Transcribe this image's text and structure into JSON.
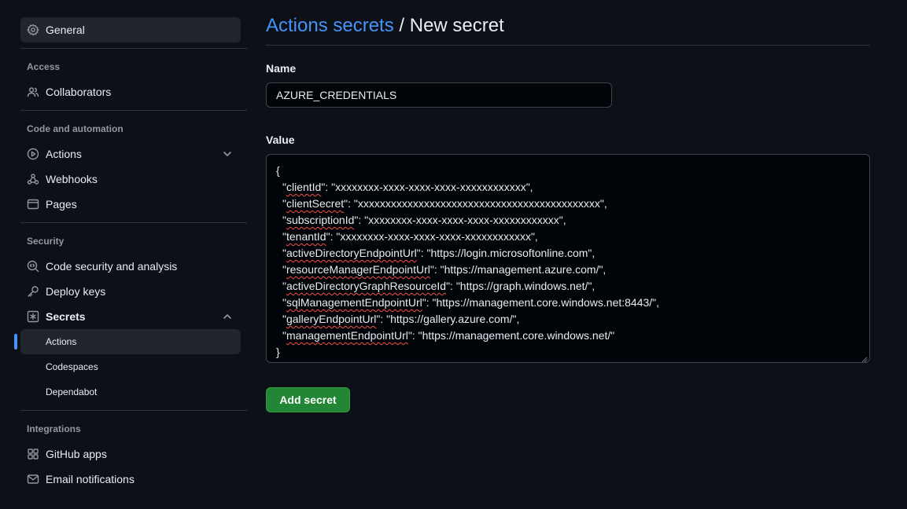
{
  "sidebar": {
    "general": "General",
    "access": {
      "heading": "Access",
      "collaborators": "Collaborators"
    },
    "code_automation": {
      "heading": "Code and automation",
      "actions": "Actions",
      "webhooks": "Webhooks",
      "pages": "Pages"
    },
    "security": {
      "heading": "Security",
      "code_security": "Code security and analysis",
      "deploy_keys": "Deploy keys",
      "secrets": "Secrets",
      "secrets_items": [
        "Actions",
        "Codespaces",
        "Dependabot"
      ]
    },
    "integrations": {
      "heading": "Integrations",
      "github_apps": "GitHub apps",
      "email_notifications": "Email notifications"
    }
  },
  "header": {
    "link": "Actions secrets",
    "separator": "/",
    "current": "New secret"
  },
  "form": {
    "name_label": "Name",
    "name_value": "AZURE_CREDENTIALS",
    "value_label": "Value",
    "value_lines": [
      {
        "pre": "",
        "key": "",
        "post": "{",
        "indent": false
      },
      {
        "pre": "\"",
        "key": "clientId",
        "post": "\": \"xxxxxxxx-xxxx-xxxx-xxxx-xxxxxxxxxxxx\",",
        "indent": true
      },
      {
        "pre": "\"",
        "key": "clientSecret",
        "post": "\": \"xxxxxxxxxxxxxxxxxxxxxxxxxxxxxxxxxxxxxxxxxxxx\",",
        "indent": true
      },
      {
        "pre": "\"",
        "key": "subscriptionId",
        "post": "\": \"xxxxxxxx-xxxx-xxxx-xxxx-xxxxxxxxxxxx\",",
        "indent": true
      },
      {
        "pre": "\"",
        "key": "tenantId",
        "post": "\": \"xxxxxxxx-xxxx-xxxx-xxxx-xxxxxxxxxxxx\",",
        "indent": true
      },
      {
        "pre": "\"",
        "key": "activeDirectoryEndpointUrl",
        "post": "\": \"https://login.microsoftonline.com\",",
        "indent": true
      },
      {
        "pre": "\"",
        "key": "resourceManagerEndpointUrl",
        "post": "\": \"https://management.azure.com/\",",
        "indent": true
      },
      {
        "pre": "\"",
        "key": "activeDirectoryGraphResourceId",
        "post": "\": \"https://graph.windows.net/\",",
        "indent": true
      },
      {
        "pre": "\"",
        "key": "sqlManagementEndpointUrl",
        "post": "\": \"https://management.core.windows.net:8443/\",",
        "indent": true
      },
      {
        "pre": "\"",
        "key": "galleryEndpointUrl",
        "post": "\": \"https://gallery.azure.com/\",",
        "indent": true
      },
      {
        "pre": "\"",
        "key": "managementEndpointUrl",
        "post": "\": \"https://management.core.windows.net/\"",
        "indent": true
      },
      {
        "pre": "",
        "key": "",
        "post": "}",
        "indent": false
      }
    ],
    "submit_label": "Add secret"
  },
  "colors": {
    "background": "#0d1117",
    "link": "#4493f8",
    "button": "#238636",
    "spellcheck": "#f85149"
  }
}
